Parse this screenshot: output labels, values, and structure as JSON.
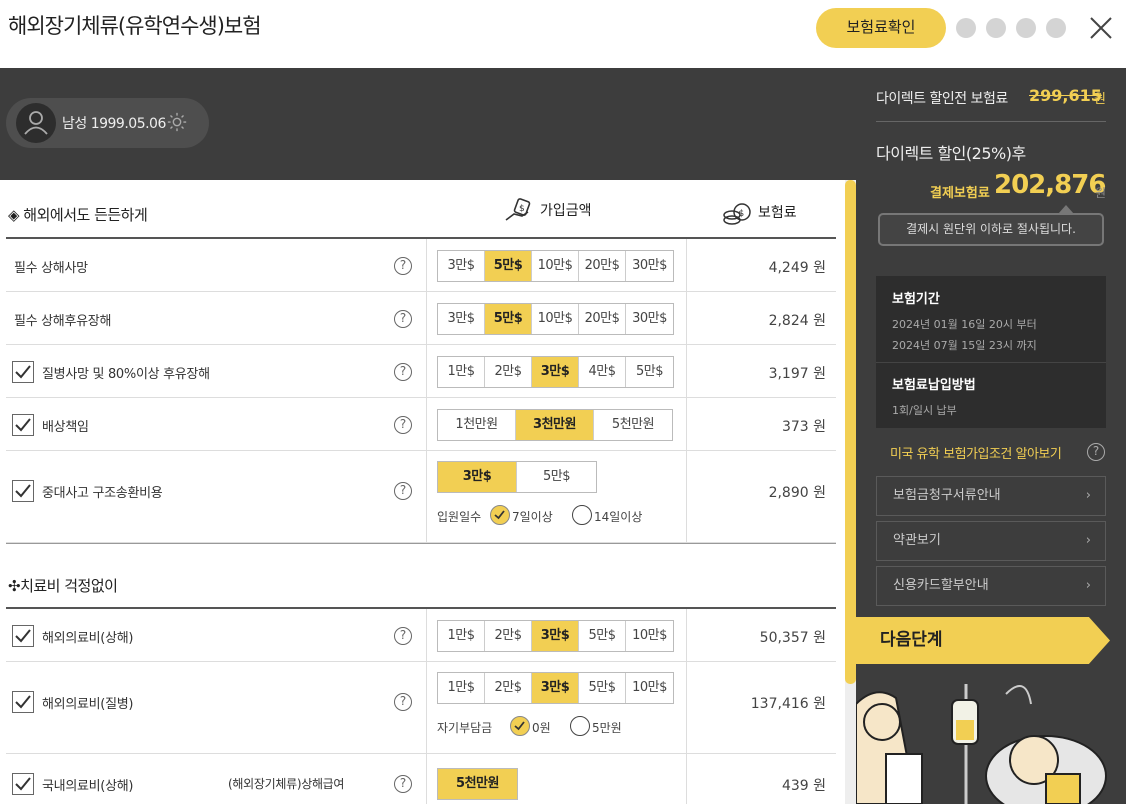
{
  "header": {
    "title": "해외장기체류(유학연수생)보험",
    "premium_check_label": "보험료확인"
  },
  "profile": {
    "text": "남성 1999.05.06"
  },
  "summary": {
    "before_discount_label": "다이렉트 할인전 보험료",
    "before_discount_value": "299,615",
    "won": "원",
    "after_discount_label": "다이렉트 할인(25%)후",
    "pay_label": "결제보험료",
    "pay_value": "202,876",
    "tooltip": "결제시 원단위 이하로 절사됩니다.",
    "period_title": "보험기간",
    "period_from": "2024년 01월 16일 20시 부터",
    "period_to": "2024년 07월 15일 23시 까지",
    "method_title": "보험료납입방법",
    "method_value": "1회/일시 납부",
    "us_link": "미국 유학 보험가입조건 알아보기",
    "menu": [
      "보험금청구서류안내",
      "약관보기",
      "신용카드할부안내"
    ],
    "next_label": "다음단계"
  },
  "section1": {
    "title": "◈ 해외에서도 든든하게",
    "col_amount": "가입금액",
    "col_premium": "보험료",
    "rows": [
      {
        "name": "필수 상해사망",
        "options": [
          "3만$",
          "5만$",
          "10만$",
          "20만$",
          "30만$"
        ],
        "selected": 1,
        "price": "4,249 원"
      },
      {
        "name": "필수 상해후유장해",
        "options": [
          "3만$",
          "5만$",
          "10만$",
          "20만$",
          "30만$"
        ],
        "selected": 1,
        "price": "2,824 원"
      },
      {
        "name": "질병사망 및 80%이상 후유장해",
        "options": [
          "1만$",
          "2만$",
          "3만$",
          "4만$",
          "5만$"
        ],
        "selected": 2,
        "price": "3,197 원"
      },
      {
        "name": "배상책임",
        "options": [
          "1천만원",
          "3천만원",
          "5천만원"
        ],
        "selected": 1,
        "price": "373 원"
      },
      {
        "name": "중대사고 구조송환비용",
        "options": [
          "3만$",
          "5만$"
        ],
        "selected": 0,
        "price": "2,890 원",
        "radio_label": "입원일수",
        "radios": [
          "7일이상",
          "14일이상"
        ],
        "radio_selected": 0
      }
    ]
  },
  "section2": {
    "title": "✣치료비 걱정없이",
    "rows": [
      {
        "name": "해외의료비(상해)",
        "options": [
          "1만$",
          "2만$",
          "3만$",
          "5만$",
          "10만$"
        ],
        "selected": 2,
        "price": "50,357 원"
      },
      {
        "name": "해외의료비(질병)",
        "options": [
          "1만$",
          "2만$",
          "3만$",
          "5만$",
          "10만$"
        ],
        "selected": 2,
        "price": "137,416 원",
        "radio_label": "자기부담금",
        "radios": [
          "0원",
          "5만원"
        ],
        "radio_selected": 0
      },
      {
        "name": "국내의료비(상해)",
        "sub_name": "(해외장기체류)상해급여",
        "options": [
          "5천만원"
        ],
        "selected": 0,
        "price": "439 원"
      }
    ]
  }
}
